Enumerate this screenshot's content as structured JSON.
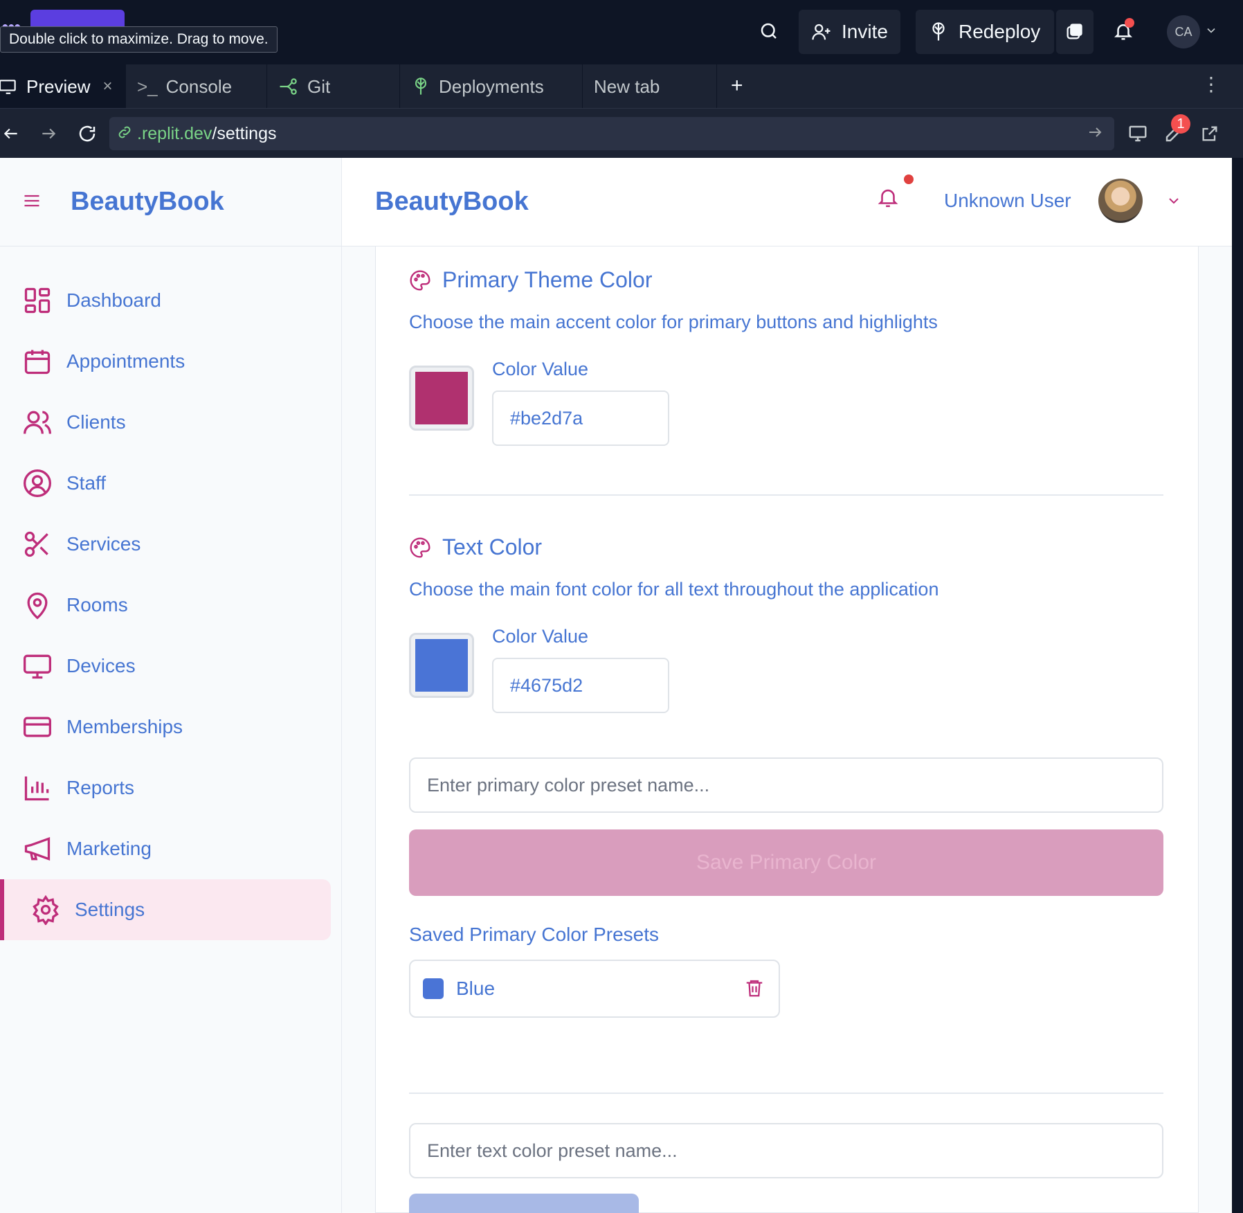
{
  "ide": {
    "tooltip": "Double click to maximize. Drag to move.",
    "invite_label": "Invite",
    "redeploy_label": "Redeploy",
    "user_initials": "CA"
  },
  "tabs": [
    {
      "label": "Preview",
      "active": true
    },
    {
      "label": "Console"
    },
    {
      "label": "Git"
    },
    {
      "label": "Deployments"
    },
    {
      "label": "New tab"
    }
  ],
  "urlbar": {
    "domain": ".replit.dev",
    "path": "/settings",
    "devtools_badge": "1"
  },
  "app": {
    "brand": "BeautyBook",
    "header_title": "BeautyBook",
    "user_name": "Unknown User",
    "accent_color": "#be2d7a",
    "text_color": "#4675d2"
  },
  "sidebar": {
    "items": [
      {
        "label": "Dashboard",
        "icon": "dashboard-icon"
      },
      {
        "label": "Appointments",
        "icon": "calendar-icon"
      },
      {
        "label": "Clients",
        "icon": "users-icon"
      },
      {
        "label": "Staff",
        "icon": "user-circle-icon"
      },
      {
        "label": "Services",
        "icon": "scissors-icon"
      },
      {
        "label": "Rooms",
        "icon": "map-pin-icon"
      },
      {
        "label": "Devices",
        "icon": "monitor-icon"
      },
      {
        "label": "Memberships",
        "icon": "credit-card-icon"
      },
      {
        "label": "Reports",
        "icon": "bar-chart-icon"
      },
      {
        "label": "Marketing",
        "icon": "megaphone-icon"
      },
      {
        "label": "Settings",
        "icon": "gear-icon",
        "active": true
      }
    ]
  },
  "primary": {
    "title": "Primary Theme Color",
    "description": "Choose the main accent color for primary buttons and highlights",
    "value_label": "Color Value",
    "value": "#be2d7a"
  },
  "text_color": {
    "title": "Text Color",
    "description": "Choose the main font color for all text throughout the application",
    "value_label": "Color Value",
    "value": "#4675d2"
  },
  "primary_preset": {
    "placeholder": "Enter primary color preset name...",
    "save_label": "Save Primary Color",
    "saved_title": "Saved Primary Color Presets",
    "presets": [
      {
        "name": "Blue",
        "color": "#4675d2"
      }
    ]
  },
  "text_preset": {
    "placeholder": "Enter text color preset name..."
  }
}
